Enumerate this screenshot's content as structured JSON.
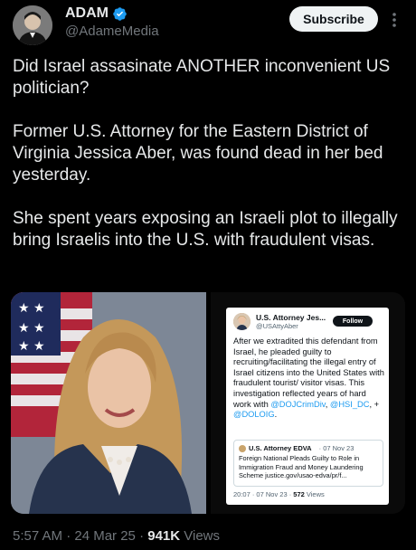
{
  "author": {
    "name": "ADAM",
    "handle": "@AdameMedia",
    "verified": true
  },
  "actions": {
    "subscribe_label": "Subscribe",
    "more_icon": "more-vertical-icon"
  },
  "tweet": {
    "paragraphs": [
      "Did Israel assasinate ANOTHER inconvenient US politician?",
      "Former U.S. Attorney for the Eastern District of Virginia Jessica Aber, was found dead in her bed yesterday.",
      "She spent years exposing an Israeli plot to illegally bring Israelis into the U.S. with fraudulent visas."
    ]
  },
  "embedded_post": {
    "name": "U.S. Attorney Jes...",
    "handle": "@USAttyAber",
    "follow_label": "Follow",
    "body_text": "After we extradited this defendant from Israel, he pleaded guilty to recruiting/facilitating the illegal entry of Israel citizens into the United States with fraudulent tourist/ visitor visas. This investigation reflected years of hard work with",
    "mention_1": "@DOJCrimDiv",
    "mention_2": "@HSI_DC",
    "mention_3": "@DOLOIG",
    "quote": {
      "name": "U.S. Attorney EDVA",
      "date": "07 Nov 23",
      "text": "Foreign National Pleads Guilty to Role in Immigration Fraud and Money Laundering Scheme justice.gov/usao-edva/pr/f..."
    },
    "timestamp": "20:07 · 07 Nov 23 · ",
    "views_count": "572",
    "views_label": " Views"
  },
  "footer": {
    "timestamp": "5:57 AM · 24 Mar 25 · ",
    "views_count": "941K",
    "views_label": " Views"
  },
  "colors": {
    "background": "#000000",
    "text": "#e7e9ea",
    "muted": "#71767b",
    "verified": "#1d9bf0",
    "link": "#1d9bf0"
  }
}
